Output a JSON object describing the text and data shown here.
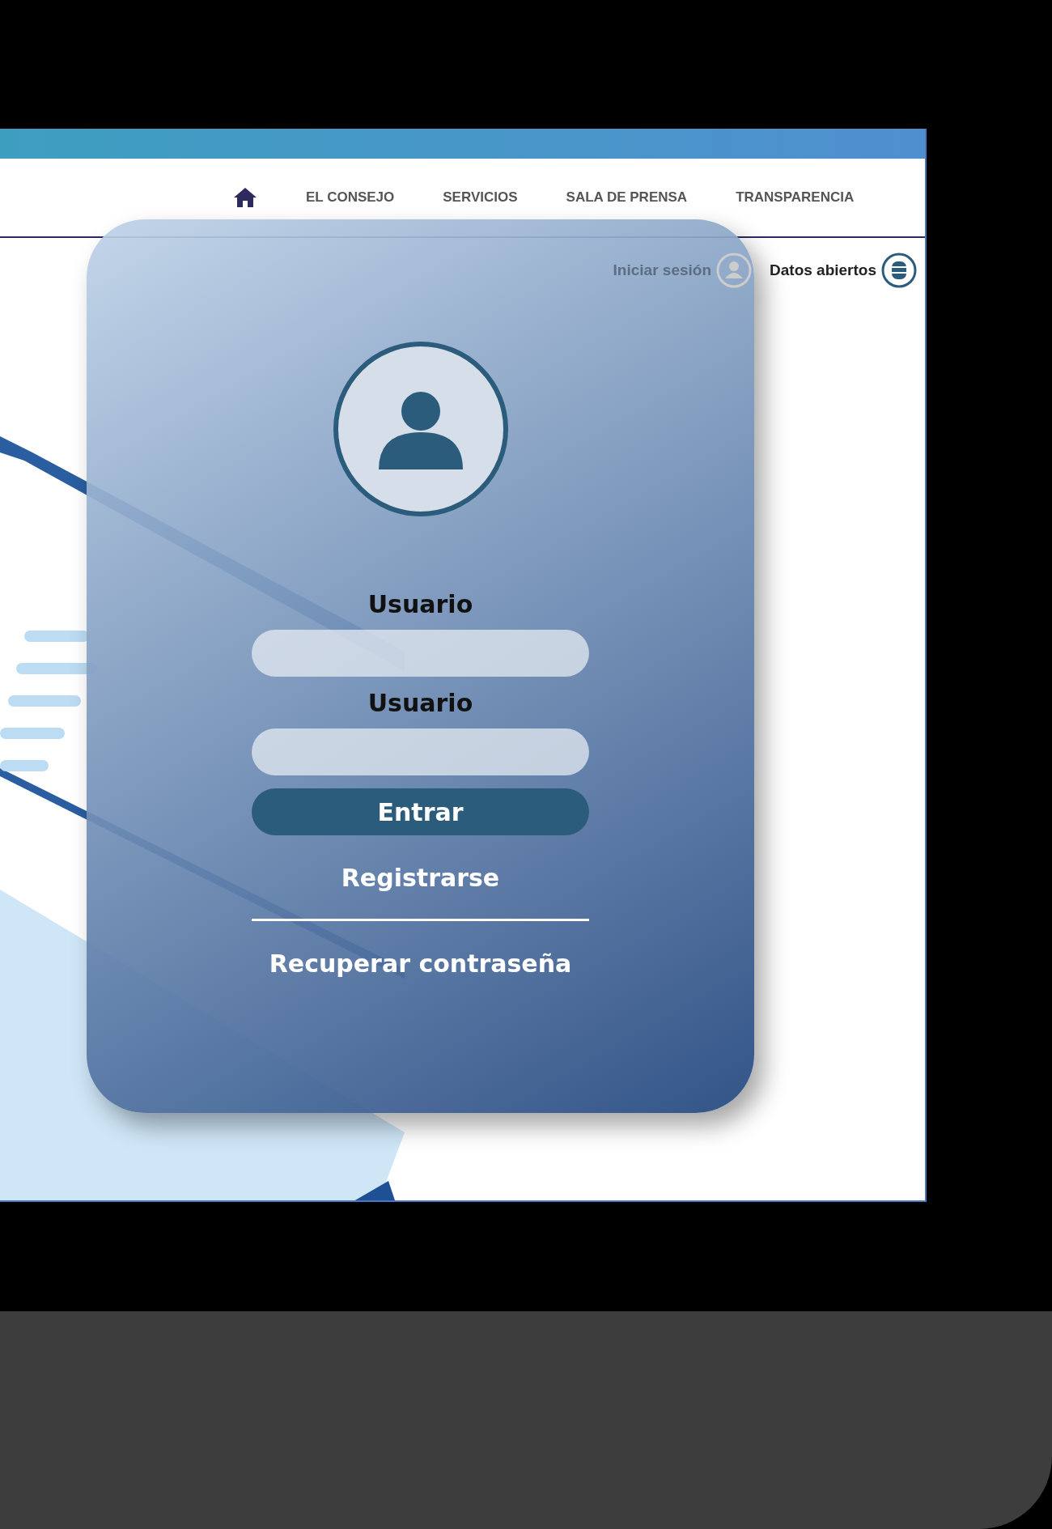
{
  "nav": {
    "items": [
      {
        "kind": "home"
      },
      {
        "kind": "link",
        "label": "EL CONSEJO"
      },
      {
        "kind": "link",
        "label": "SERVICIOS"
      },
      {
        "kind": "link",
        "label": "SALA DE PRENSA"
      },
      {
        "kind": "link",
        "label": "TRANSPARENCIA"
      }
    ]
  },
  "user_links": [
    {
      "kind": "user",
      "label": "Iniciar sesión"
    },
    {
      "kind": "database",
      "label": "Datos abiertos"
    }
  ],
  "login": {
    "fields": [
      {
        "label": "Usuario"
      },
      {
        "label": "Usuario"
      }
    ],
    "button": "Entrar",
    "register": "Registrarse",
    "recover": "Recuperar contraseña"
  }
}
